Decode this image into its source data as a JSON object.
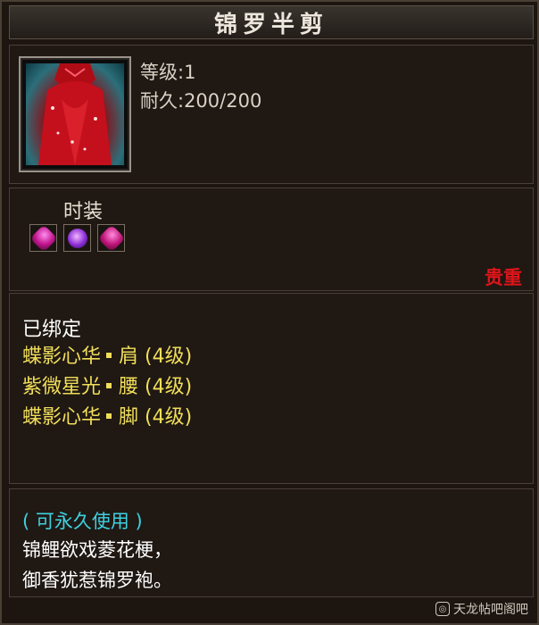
{
  "title": "锦罗半剪",
  "item": {
    "level": "等级:1",
    "durability": "耐久:200/200",
    "category": "时装",
    "gems": [
      "pink-gem",
      "purple-gem",
      "pink-gem"
    ],
    "rarity": "贵重"
  },
  "binding": {
    "status": "已绑定",
    "set_items": [
      {
        "name": "蝶影心华",
        "part": "肩 (4级)"
      },
      {
        "name": "紫微星光",
        "part": "腰 (4级)"
      },
      {
        "name": "蝶影心华",
        "part": "脚 (4级)"
      }
    ]
  },
  "description": {
    "usage": "( 可永久使用 )",
    "poem_line_1": "锦鲤欲戏菱花梗，",
    "poem_line_2": "御香犹惹锦罗袍。"
  },
  "watermark": "天龙帖吧阁吧",
  "colors": {
    "set_text": "#f1de5a",
    "rarity": "#e0141a",
    "usage": "#3fd0e0"
  }
}
